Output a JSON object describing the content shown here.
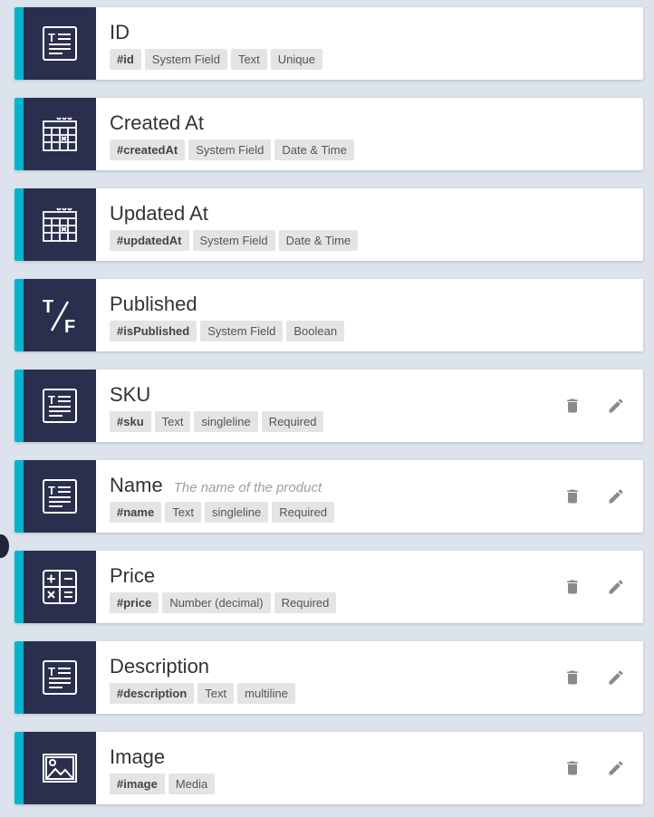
{
  "accent_color": "#00b5ce",
  "icon_bg_color": "#2a2f4d",
  "fields": [
    {
      "title": "ID",
      "description": "",
      "icon": "text-field-icon",
      "editable": false,
      "tags": [
        "#id",
        "System Field",
        "Text",
        "Unique"
      ]
    },
    {
      "title": "Created At",
      "description": "",
      "icon": "calendar-icon",
      "editable": false,
      "tags": [
        "#createdAt",
        "System Field",
        "Date & Time"
      ]
    },
    {
      "title": "Updated At",
      "description": "",
      "icon": "calendar-icon",
      "editable": false,
      "tags": [
        "#updatedAt",
        "System Field",
        "Date & Time"
      ]
    },
    {
      "title": "Published",
      "description": "",
      "icon": "boolean-icon",
      "editable": false,
      "tags": [
        "#isPublished",
        "System Field",
        "Boolean"
      ]
    },
    {
      "title": "SKU",
      "description": "",
      "icon": "text-field-icon",
      "editable": true,
      "tags": [
        "#sku",
        "Text",
        "singleline",
        "Required"
      ]
    },
    {
      "title": "Name",
      "description": "The name of the product",
      "icon": "text-field-icon",
      "editable": true,
      "tags": [
        "#name",
        "Text",
        "singleline",
        "Required"
      ]
    },
    {
      "title": "Price",
      "description": "",
      "icon": "calculator-icon",
      "editable": true,
      "tags": [
        "#price",
        "Number (decimal)",
        "Required"
      ]
    },
    {
      "title": "Description",
      "description": "",
      "icon": "text-field-icon",
      "editable": true,
      "tags": [
        "#description",
        "Text",
        "multiline"
      ]
    },
    {
      "title": "Image",
      "description": "",
      "icon": "image-icon",
      "editable": true,
      "tags": [
        "#image",
        "Media"
      ]
    }
  ]
}
